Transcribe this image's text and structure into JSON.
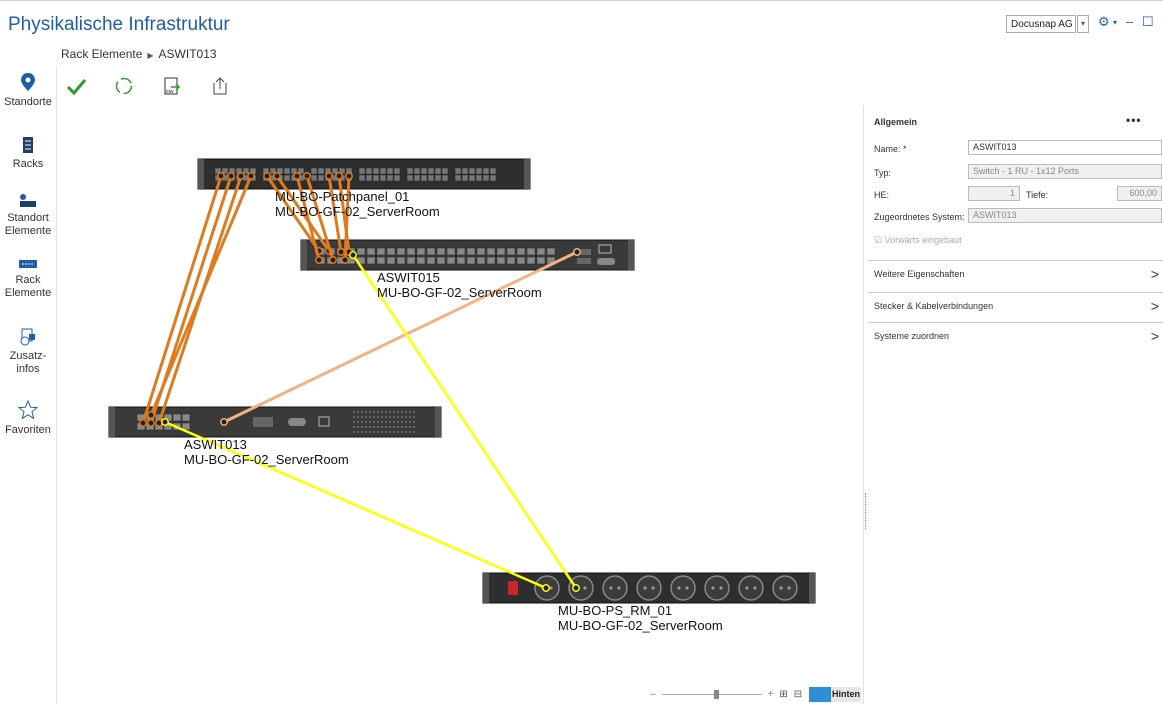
{
  "app": {
    "title": "Physikalische Infrastruktur",
    "company": "Docusnap AG"
  },
  "breadcrumb": {
    "parent": "Rack Elemente",
    "current": "ASWIT013"
  },
  "nav": [
    {
      "label_1": "Standorte",
      "label_2": ""
    },
    {
      "label_1": "Racks",
      "label_2": ""
    },
    {
      "label_1": "Standort",
      "label_2": "Elemente"
    },
    {
      "label_1": "Rack",
      "label_2": "Elemente"
    },
    {
      "label_1": "Zusatz-",
      "label_2": "infos"
    },
    {
      "label_1": "Favoriten",
      "label_2": ""
    }
  ],
  "devices": [
    {
      "name": "MU-BO-Patchpanel_01",
      "room": "MU-BO-GF-02_ServerRoom"
    },
    {
      "name": "ASWIT015",
      "room": "MU-BO-GF-02_ServerRoom"
    },
    {
      "name": "ASWIT013",
      "room": "MU-BO-GF-02_ServerRoom"
    },
    {
      "name": "MU-BO-PS_RM_01",
      "room": "MU-BO-GF-02_ServerRoom"
    }
  ],
  "colors": {
    "accent": "#1e5fa8",
    "cable_orange": "#e07a1f",
    "cable_peach": "#f4b183",
    "cable_yellow": "#ffff00",
    "device_body": "#3a3a3a"
  },
  "zoom": {
    "minus": "–",
    "plus": "+",
    "mode_label": "Hinten"
  },
  "panel": {
    "section_title": "Allgemein",
    "more": "•••",
    "name_label": "Name: *",
    "name_value": "ASWIT013",
    "type_label": "Typ:",
    "type_value": "Switch - 1 RU - 1x12 Ports",
    "he_label": "HE:",
    "he_value": "1",
    "depth_label": "Tiefe:",
    "depth_value": "600,00",
    "system_label": "Zugeordnetes System:",
    "system_value": "ASWIT013",
    "forward_label": "Vorwärts eingebaut",
    "sections": [
      "Weitere Eigenschaften",
      "Stecker & Kabelverbindungen",
      "Systeme zuordnen"
    ]
  }
}
